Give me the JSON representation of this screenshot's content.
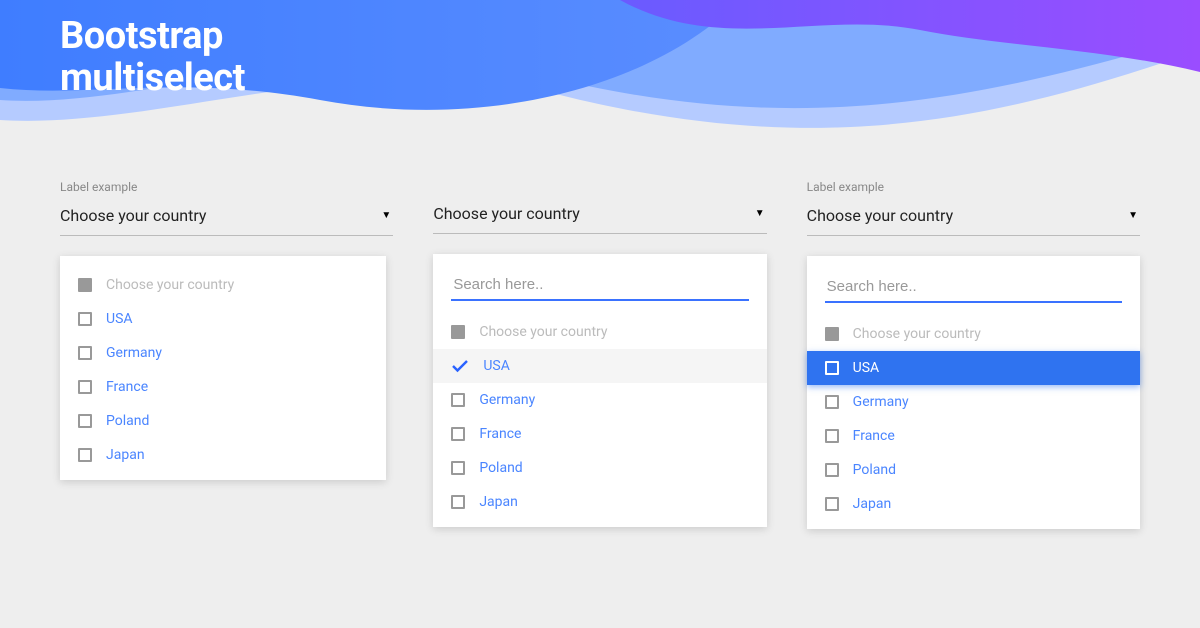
{
  "page_title": "Bootstrap\nmultiselect",
  "colors": {
    "accent_blue": "#2f73f0",
    "link_blue": "#4a85ff",
    "wave_blue_mid": "#7aa7ff",
    "wave_blue_light": "#b5cbff",
    "wave_purple": "#8645ff",
    "bg_grey": "#eeeeee"
  },
  "col1": {
    "label": "Label example",
    "trigger": "Choose your country",
    "header_option": "Choose your country",
    "options": [
      "USA",
      "Germany",
      "France",
      "Poland",
      "Japan"
    ]
  },
  "col2": {
    "trigger": "Choose your country",
    "search_placeholder": "Search here..",
    "header_option": "Choose your country",
    "options": [
      "USA",
      "Germany",
      "France",
      "Poland",
      "Japan"
    ],
    "checked_index": 0
  },
  "col3": {
    "label": "Label example",
    "trigger": "Choose your country",
    "search_placeholder": "Search here..",
    "header_option": "Choose your country",
    "options": [
      "USA",
      "Germany",
      "France",
      "Poland",
      "Japan"
    ],
    "highlight_index": 0
  }
}
